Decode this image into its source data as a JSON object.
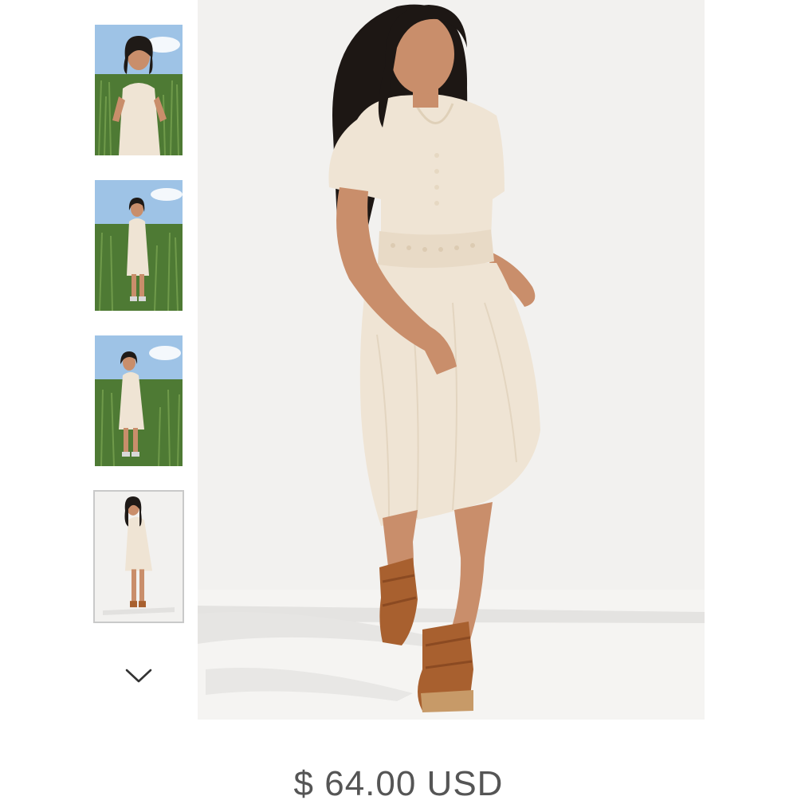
{
  "product": {
    "price": "$ 64.00 USD"
  },
  "gallery": {
    "thumbnails": [
      {
        "alt": "field-closeup"
      },
      {
        "alt": "field-full"
      },
      {
        "alt": "field-walking"
      },
      {
        "alt": "studio-full"
      }
    ],
    "selected_index": 3,
    "scroll_icon": "chevron-down-icon"
  },
  "colors": {
    "dress": "#efe4d4",
    "sky": "#9ec3e6",
    "field": "#4e7a34",
    "studio_bg": "#f2f1ef",
    "sandal": "#a8602f",
    "price_text": "#555555"
  }
}
